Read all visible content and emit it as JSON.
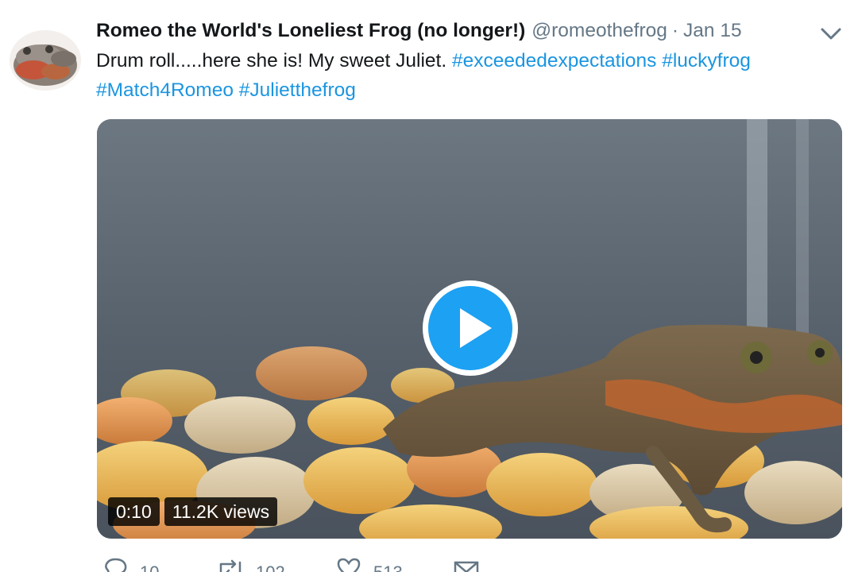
{
  "author": {
    "display_name": "Romeo the World's Loneliest Frog (no longer!)",
    "handle": "@romeothefrog",
    "separator": "·",
    "date": "Jan 15"
  },
  "tweet": {
    "text_prefix": "Drum roll.....here she is! My sweet Juliet. ",
    "hashtags": [
      "#exceededexpectations",
      "#luckyfrog",
      "#Match4Romeo",
      "#Julietthefrog"
    ]
  },
  "video": {
    "duration": "0:10",
    "views": "11.2K views"
  },
  "actions": {
    "reply_count": "10",
    "retweet_count": "102",
    "like_count": "513"
  },
  "icons": {
    "menu": "chevron-down-icon",
    "play": "play-icon",
    "reply": "reply-icon",
    "retweet": "retweet-icon",
    "like": "heart-icon",
    "dm": "envelope-icon"
  },
  "colors": {
    "link": "#1b95e0",
    "secondary_text": "#657786",
    "play_button": "#1da1f2"
  }
}
